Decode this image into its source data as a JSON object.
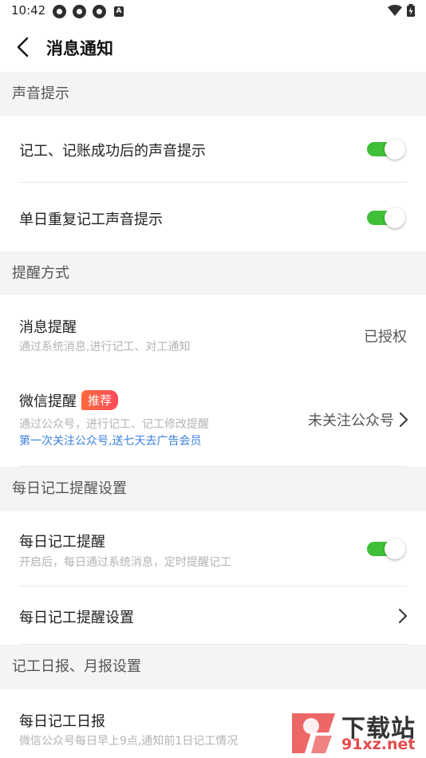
{
  "status_bar": {
    "time": "10:42",
    "badge_letter": "A"
  },
  "header": {
    "title": "消息通知"
  },
  "sections": {
    "sound": {
      "header": "声音提示",
      "row1": {
        "title": "记工、记账成功后的声音提示",
        "toggle_on": true
      },
      "row2": {
        "title": "单日重复记工声音提示",
        "toggle_on": true
      }
    },
    "reminder": {
      "header": "提醒方式",
      "message": {
        "title": "消息提醒",
        "subtitle": "通过系统消息,进行记工、对工通知",
        "value": "已授权"
      },
      "wechat": {
        "title": "微信提醒",
        "badge": "推荐",
        "subtitle": "通过公众号，进行记工、记工修改提醒",
        "promo": "第一次关注公众号,送七天去广告会员",
        "value": "未关注公众号"
      }
    },
    "daily": {
      "header": "每日记工提醒设置",
      "toggle_row": {
        "title": "每日记工提醒",
        "subtitle": "开启后，每日通过系统消息，定时提醒记工",
        "toggle_on": true
      },
      "settings_row": {
        "title": "每日记工提醒设置"
      }
    },
    "report": {
      "header": "记工日报、月报设置",
      "daily_report": {
        "title": "每日记工日报",
        "subtitle": "微信公众号每日早上9点,通知前1日记工情况"
      }
    }
  },
  "watermark": {
    "text_cn": "下载站",
    "text_domain": "91xz.net"
  },
  "colors": {
    "toggle_on": "#3fbf38",
    "promo_link": "#3d7fe0",
    "badge": "#ff5a48",
    "section_bg": "#f4f4f6"
  }
}
